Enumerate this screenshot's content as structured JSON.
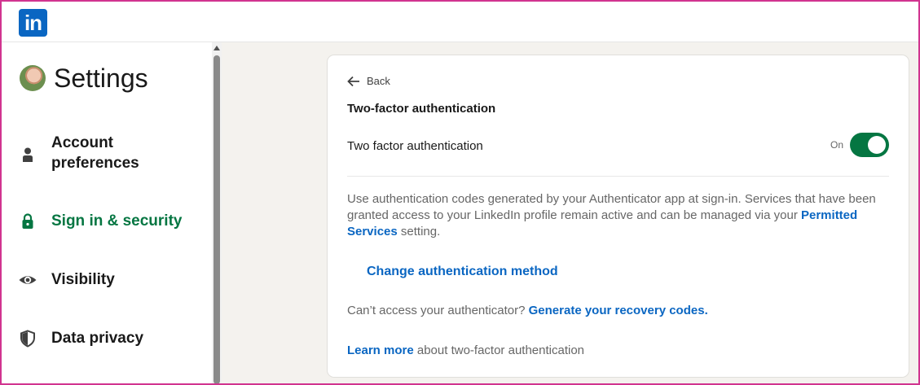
{
  "header": {
    "logo_text": "in"
  },
  "sidebar": {
    "title": "Settings",
    "items": [
      {
        "label": "Account preferences",
        "icon": "person-icon",
        "active": false
      },
      {
        "label": "Sign in & security",
        "icon": "lock-icon",
        "active": true
      },
      {
        "label": "Visibility",
        "icon": "eye-icon",
        "active": false
      },
      {
        "label": "Data privacy",
        "icon": "shield-icon",
        "active": false
      }
    ]
  },
  "content": {
    "back_label": "Back",
    "section_title": "Two-factor authentication",
    "toggle_label": "Two factor authentication",
    "toggle_state": "On",
    "description_part1": "Use authentication codes generated by your Authenticator app at sign-in. Services that have been granted access to your LinkedIn profile remain active and can be managed via your",
    "permitted_services_link": "Permitted Services",
    "description_part2": "setting.",
    "change_method_label": "Change authentication method",
    "recovery_prompt": "Can’t access your authenticator?",
    "recovery_link": "Generate your recovery codes.",
    "learn_more_link": "Learn more",
    "learn_more_text": "about two-factor authentication"
  },
  "colors": {
    "brand": "#0a66c2",
    "active_green": "#057642",
    "frame": "#d1348f"
  }
}
